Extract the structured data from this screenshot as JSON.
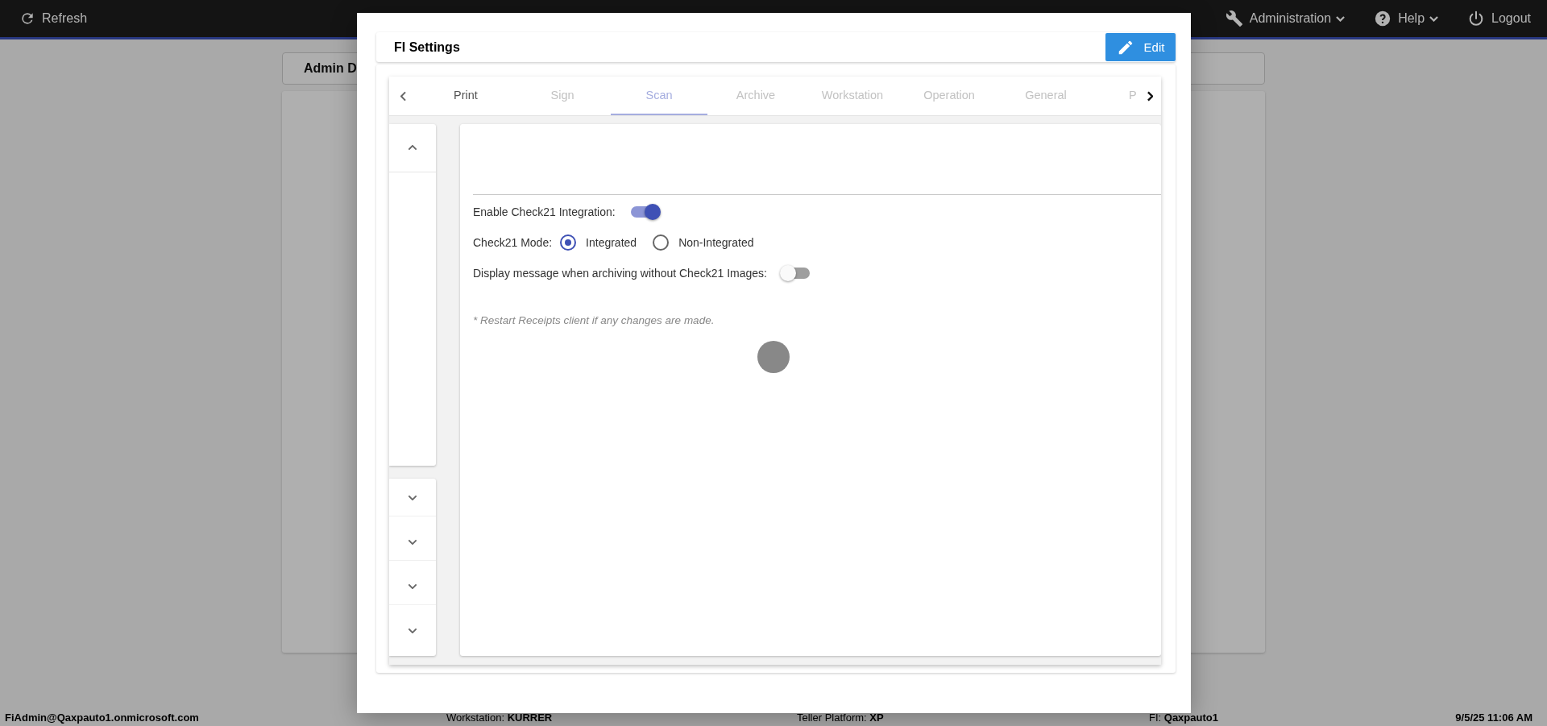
{
  "top_bar": {
    "refresh": "Refresh",
    "menus": [
      {
        "label": "Administration",
        "kind": "wrench",
        "dropdown": true
      },
      {
        "label": "Help",
        "kind": "help",
        "dropdown": true
      },
      {
        "label": "Logout",
        "kind": "power",
        "dropdown": false
      }
    ]
  },
  "background_card": {
    "title": "Admin D"
  },
  "dialog": {
    "title": "FI Settings",
    "edit_button": "Edit",
    "tabs": [
      {
        "label": "Print",
        "selected": false,
        "disabled": false
      },
      {
        "label": "Sign",
        "selected": false,
        "disabled": true
      },
      {
        "label": "Scan",
        "selected": true,
        "disabled": true
      },
      {
        "label": "Archive",
        "selected": false,
        "disabled": true
      },
      {
        "label": "Workstation",
        "selected": false,
        "disabled": true
      },
      {
        "label": "Operation",
        "selected": false,
        "disabled": true
      },
      {
        "label": "General",
        "selected": false,
        "disabled": true
      },
      {
        "label": "P",
        "selected": false,
        "disabled": true
      }
    ],
    "side_sections": [
      {
        "expanded": true
      },
      {
        "expanded": false
      },
      {
        "expanded": false
      },
      {
        "expanded": false
      },
      {
        "expanded": false
      }
    ],
    "settings": [
      {
        "kind": "toggle",
        "label": "Enable Check21 Integration:",
        "on": true
      },
      {
        "kind": "radio",
        "label": "Check21 Mode:",
        "options": [
          {
            "label": "Integrated",
            "selected": true
          },
          {
            "label": "Non-Integrated",
            "selected": false
          }
        ]
      },
      {
        "kind": "toggle",
        "label": "Display message when archiving without Check21 Images:",
        "on": false
      }
    ],
    "note": "* Restart Receipts client if any changes are made.",
    "loading": true
  },
  "status_bar": {
    "user": "FiAdmin@Qaxpauto1.onmicrosoft.com",
    "items": [
      {
        "label": "Workstation:",
        "value": "KURRER"
      },
      {
        "label": "Teller Platform:",
        "value": "XP"
      },
      {
        "label": "FI:",
        "value": "Qaxpauto1"
      }
    ],
    "datetime": "9/5/25 11:06 AM"
  }
}
